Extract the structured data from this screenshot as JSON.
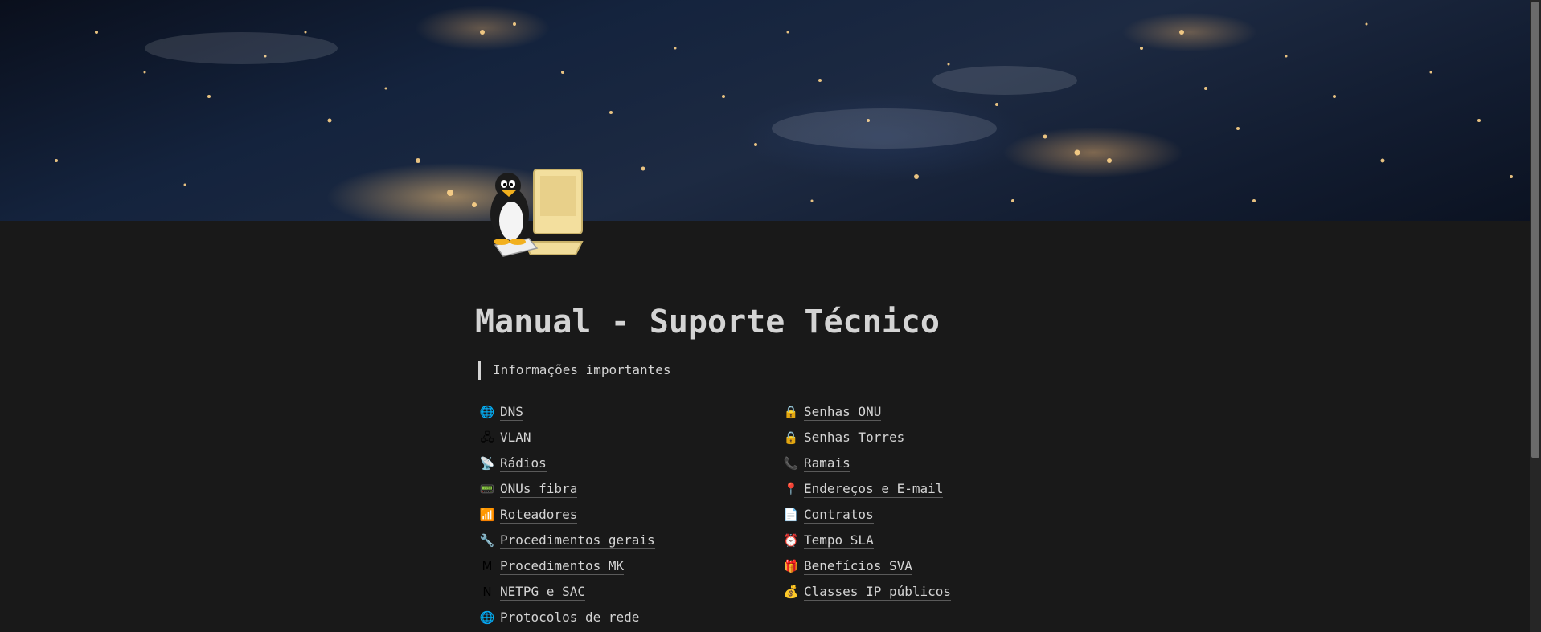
{
  "page": {
    "title": "Manual - Suporte Técnico",
    "callout": "Informações importantes",
    "icon": "tux-penguin-computer-icon",
    "cover": "earth-night-lights-cover"
  },
  "links_left": [
    {
      "label": "DNS",
      "icon": "globe-network-icon",
      "glyph": "🌐"
    },
    {
      "label": "VLAN",
      "icon": "network-topology-icon",
      "glyph": "🖧"
    },
    {
      "label": "Rádios",
      "icon": "radio-tower-icon",
      "glyph": "📡"
    },
    {
      "label": "ONUs fibra",
      "icon": "onu-device-icon",
      "glyph": "📟"
    },
    {
      "label": "Roteadores",
      "icon": "router-icon",
      "glyph": "📶"
    },
    {
      "label": "Procedimentos gerais",
      "icon": "wrench-icon",
      "glyph": "🔧"
    },
    {
      "label": "Procedimentos MK",
      "icon": "mikrotik-icon",
      "glyph": "M"
    },
    {
      "label": "NETPG e SAC",
      "icon": "netpg-icon",
      "glyph": "N"
    },
    {
      "label": "Protocolos de rede",
      "icon": "globe-icon",
      "glyph": "🌐"
    }
  ],
  "links_right": [
    {
      "label": "Senhas ONU",
      "icon": "lock-icon",
      "glyph": "🔒"
    },
    {
      "label": "Senhas Torres",
      "icon": "lock-icon",
      "glyph": "🔒"
    },
    {
      "label": "Ramais",
      "icon": "phone-icon",
      "glyph": "📞"
    },
    {
      "label": "Endereços e E-mail",
      "icon": "map-pin-icon",
      "glyph": "📍"
    },
    {
      "label": "Contratos",
      "icon": "document-icon",
      "glyph": "📄"
    },
    {
      "label": "Tempo SLA",
      "icon": "alarm-clock-icon",
      "glyph": "⏰"
    },
    {
      "label": "Benefícios SVA",
      "icon": "gift-icon",
      "glyph": "🎁"
    },
    {
      "label": "Classes IP públicos",
      "icon": "money-bag-icon",
      "glyph": "💰"
    }
  ],
  "colors": {
    "background": "#191919",
    "text": "#d4d4d4",
    "underline": "#5a5a5a"
  }
}
